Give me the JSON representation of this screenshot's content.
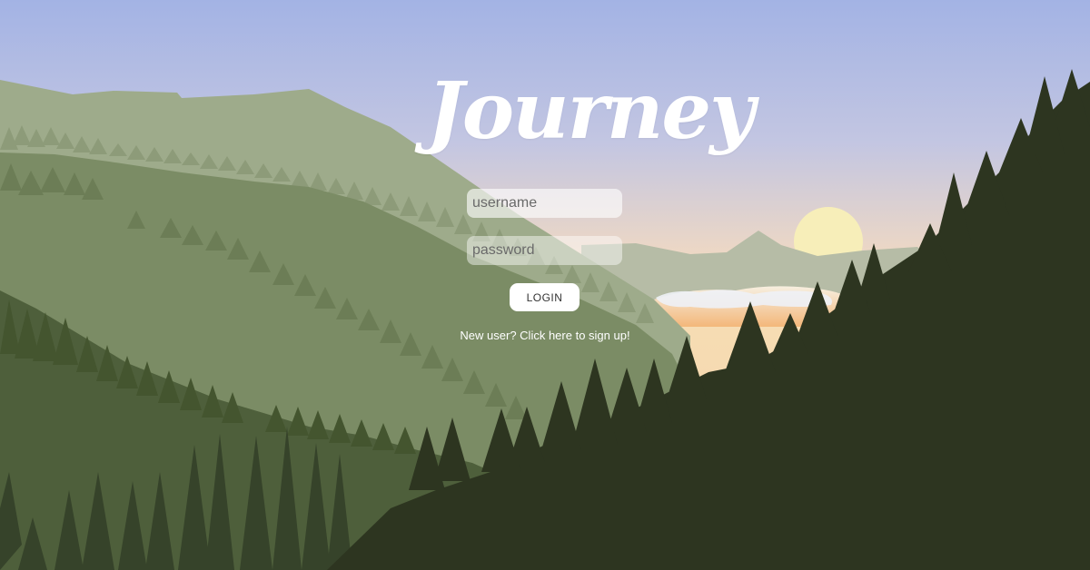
{
  "app": {
    "logo_text": "Journey"
  },
  "login_form": {
    "username_placeholder": "username",
    "password_placeholder": "password",
    "login_button_label": "LOGIN",
    "signup_link_text": "New user? Click here to sign up!"
  },
  "colors": {
    "sky_top": "#a3b3e4",
    "sky_horizon": "#f2d8b3",
    "sun": "#f7eeb9",
    "far_mountain": "#9eab8b",
    "mid_mountain": "#7b8c65",
    "near_mountain": "#4e5f3b",
    "foreground_slope": "#2d3520"
  }
}
